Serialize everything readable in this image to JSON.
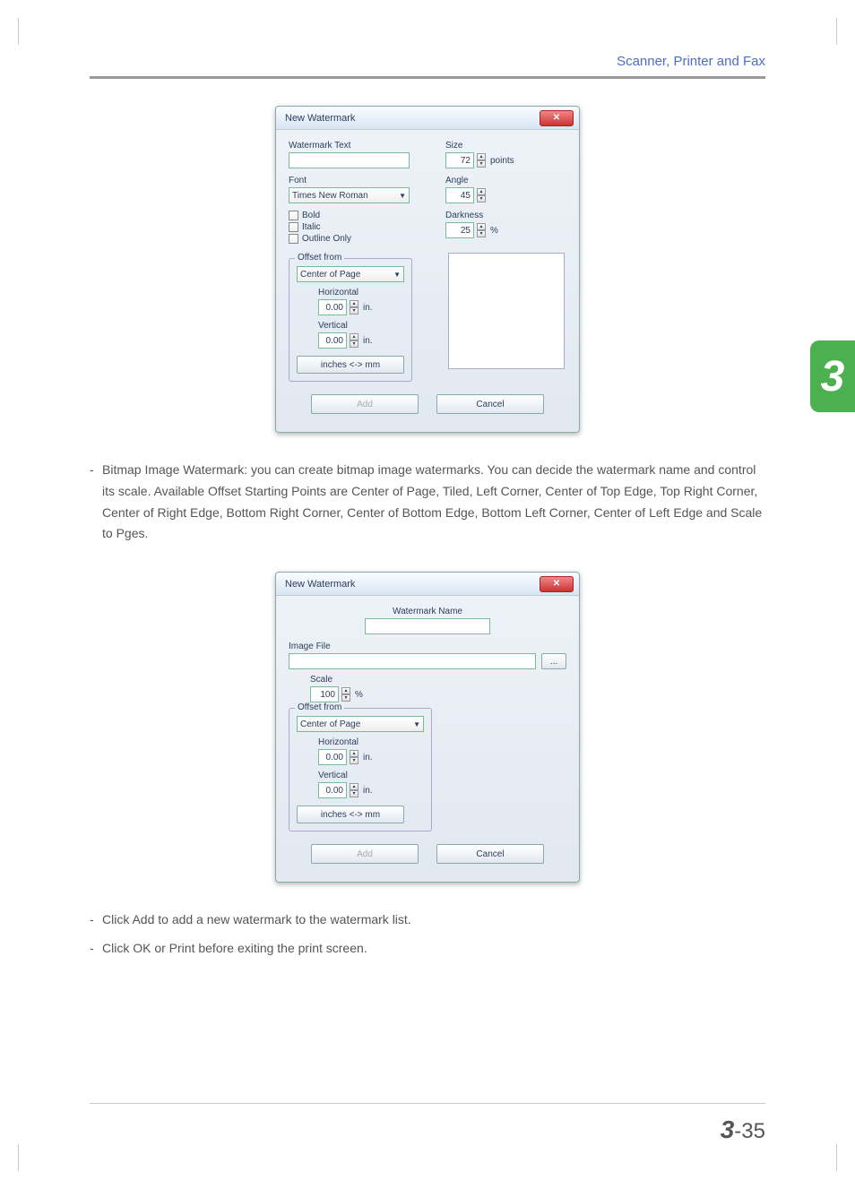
{
  "header": {
    "section": "Scanner, Printer and Fax"
  },
  "chapter_tab": "3",
  "dialog1": {
    "title": "New Watermark",
    "watermark_text_label": "Watermark Text",
    "watermark_text_value": "",
    "size_label": "Size",
    "size_value": "72",
    "size_unit": "points",
    "font_label": "Font",
    "font_value": "Times New Roman",
    "angle_label": "Angle",
    "angle_value": "45",
    "bold": "Bold",
    "italic": "Italic",
    "outline": "Outline Only",
    "darkness_label": "Darkness",
    "darkness_value": "25",
    "darkness_unit": "%",
    "offset_legend": "Offset from",
    "offset_value": "Center of Page",
    "horizontal_label": "Horizontal",
    "horizontal_value": "0.00",
    "vertical_label": "Vertical",
    "vertical_value": "0.00",
    "offset_unit": "in.",
    "convert_btn": "inches <-> mm",
    "add": "Add",
    "cancel": "Cancel"
  },
  "para1": "Bitmap Image Watermark: you can create bitmap image watermarks. You can decide the watermark name and control its scale. Available Offset Starting Points are Center of Page, Tiled,  Left Corner, Center of Top Edge, Top Right Corner, Center of Right Edge, Bottom Right Corner, Center of Bottom Edge, Bottom Left Corner, Center of Left Edge and Scale to Pges.",
  "dialog2": {
    "title": "New Watermark",
    "name_label": "Watermark Name",
    "name_value": "",
    "image_file_label": "Image File",
    "image_file_value": "",
    "browse": "...",
    "scale_label": "Scale",
    "scale_value": "100",
    "scale_unit": "%",
    "offset_legend": "Offset from",
    "offset_value": "Center of Page",
    "horizontal_label": "Horizontal",
    "horizontal_value": "0.00",
    "vertical_label": "Vertical",
    "vertical_value": "0.00",
    "offset_unit": "in.",
    "convert_btn": "inches <-> mm",
    "add": "Add",
    "cancel": "Cancel"
  },
  "bullet2": "Click Add to add a new watermark to the watermark list.",
  "bullet3": "Click OK or Print before exiting the print screen.",
  "footer": {
    "chapter": "3",
    "sep": "-",
    "page": "35"
  }
}
